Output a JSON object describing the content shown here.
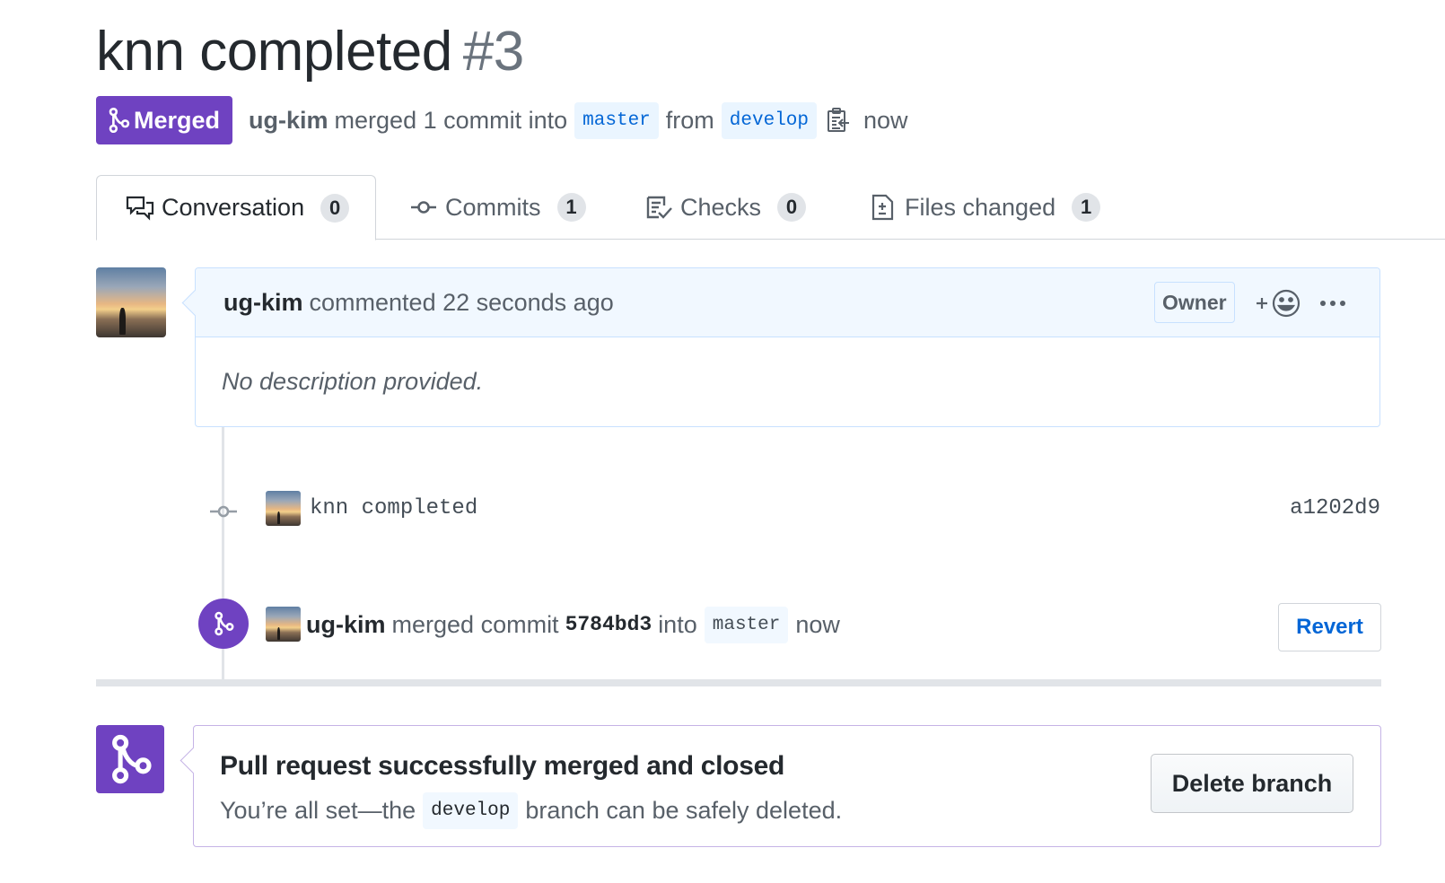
{
  "pr": {
    "title": "knn completed",
    "number": "#3",
    "state": "Merged",
    "author": "ug-kim",
    "action": "merged 1 commit into",
    "base_branch": "master",
    "from_text": "from",
    "head_branch": "develop",
    "when": "now"
  },
  "tabs": [
    {
      "label": "Conversation",
      "count": "0",
      "icon": "comment-discussion-icon"
    },
    {
      "label": "Commits",
      "count": "1",
      "icon": "git-commit-icon"
    },
    {
      "label": "Checks",
      "count": "0",
      "icon": "checklist-icon"
    },
    {
      "label": "Files changed",
      "count": "1",
      "icon": "file-diff-icon"
    }
  ],
  "comment": {
    "author": "ug-kim",
    "action": "commented 22 seconds ago",
    "role_label": "Owner",
    "reaction_label": "+",
    "body": "No description provided."
  },
  "timeline": {
    "commit": {
      "message": "knn completed",
      "sha": "a1202d9"
    },
    "merge_event": {
      "author": "ug-kim",
      "text_before": "merged commit",
      "sha": "5784bd3",
      "text_into": "into",
      "branch": "master",
      "when": "now",
      "revert_label": "Revert"
    }
  },
  "merge_box": {
    "heading": "Pull request successfully merged and closed",
    "sub_before": "You’re all set—the",
    "branch": "develop",
    "sub_after": "branch can be safely deleted.",
    "delete_label": "Delete branch"
  },
  "colors": {
    "merged_purple": "#6f42c1",
    "link_blue": "#0366d6",
    "comment_header_bg": "#f1f8ff"
  }
}
